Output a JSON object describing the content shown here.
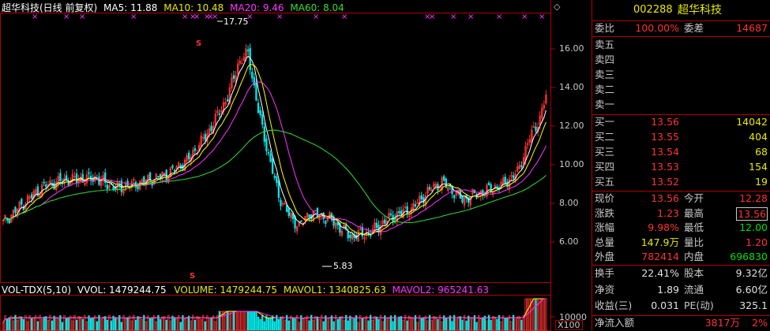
{
  "header": {
    "title": "超华科技(日线 前复权)",
    "ma5": "MA5: 11.88",
    "ma10": "MA10: 10.48",
    "ma20": "MA20: 9.46",
    "ma60": "MA60: 8.04",
    "marker_glyph": "◇"
  },
  "price_axis": {
    "ticks": [
      "16.00",
      "14.00",
      "12.00",
      "10.00",
      "8.00",
      "6.00"
    ],
    "high_label": "17.75",
    "low_label": "5.83",
    "signal_glyph": "S"
  },
  "volume_header": {
    "indicator": "VOL-TDX(5,10)",
    "vvol": "VVOL: 1479244.75",
    "volume": "VOLUME: 1479244.75",
    "mavol1": "MAVOL1: 1340825.63",
    "mavol2": "MAVOL2: 965241.63"
  },
  "volume_axis": {
    "tick": "10000",
    "unit": "X100"
  },
  "quote": {
    "code": "002288",
    "name": "超华科技",
    "weibi_label": "委比",
    "weibi": "100.00%",
    "weicha_label": "委差",
    "weicha": "14687",
    "asks": [
      {
        "label": "卖五",
        "price": "",
        "vol": ""
      },
      {
        "label": "卖四",
        "price": "",
        "vol": ""
      },
      {
        "label": "卖三",
        "price": "",
        "vol": ""
      },
      {
        "label": "卖二",
        "price": "",
        "vol": ""
      },
      {
        "label": "卖一",
        "price": "",
        "vol": ""
      }
    ],
    "bids": [
      {
        "label": "买一",
        "price": "13.56",
        "vol": "14042"
      },
      {
        "label": "买二",
        "price": "13.55",
        "vol": "404"
      },
      {
        "label": "买三",
        "price": "13.54",
        "vol": "68"
      },
      {
        "label": "买四",
        "price": "13.53",
        "vol": "154"
      },
      {
        "label": "买五",
        "price": "13.52",
        "vol": "19"
      }
    ],
    "stats": [
      {
        "l1": "现价",
        "v1": "13.56",
        "l2": "今开",
        "v2": "12.28"
      },
      {
        "l1": "涨跌",
        "v1": "1.23",
        "l2": "最高",
        "v2": "13.56"
      },
      {
        "l1": "涨幅",
        "v1": "9.98%",
        "l2": "最低",
        "v2": "12.00"
      },
      {
        "l1": "总量",
        "v1": "147.9万",
        "l2": "量比",
        "v2": "1.20"
      },
      {
        "l1": "外盘",
        "v1": "782414",
        "l2": "内盘",
        "v2": "696830"
      }
    ],
    "stats2": [
      {
        "l1": "换手",
        "v1": "22.41%",
        "l2": "股本",
        "v2": "9.32亿"
      },
      {
        "l1": "净资",
        "v1": "1.89",
        "l2": "流通",
        "v2": "6.60亿"
      },
      {
        "l1": "收益(三)",
        "v1": "0.031",
        "l2": "PE(动)",
        "v2": "325.1"
      }
    ],
    "netflow_label": "净流入额",
    "netflow_value": "3817万",
    "netflow_pct": "2%"
  },
  "colors": {
    "up": "#ff3232",
    "down": "#00e6e6",
    "ma5": "#ffffff",
    "ma10": "#ffff00",
    "ma20": "#ff33ff",
    "ma60": "#33dd33",
    "axis": "#b00000",
    "label": "#c8c8c8"
  }
}
